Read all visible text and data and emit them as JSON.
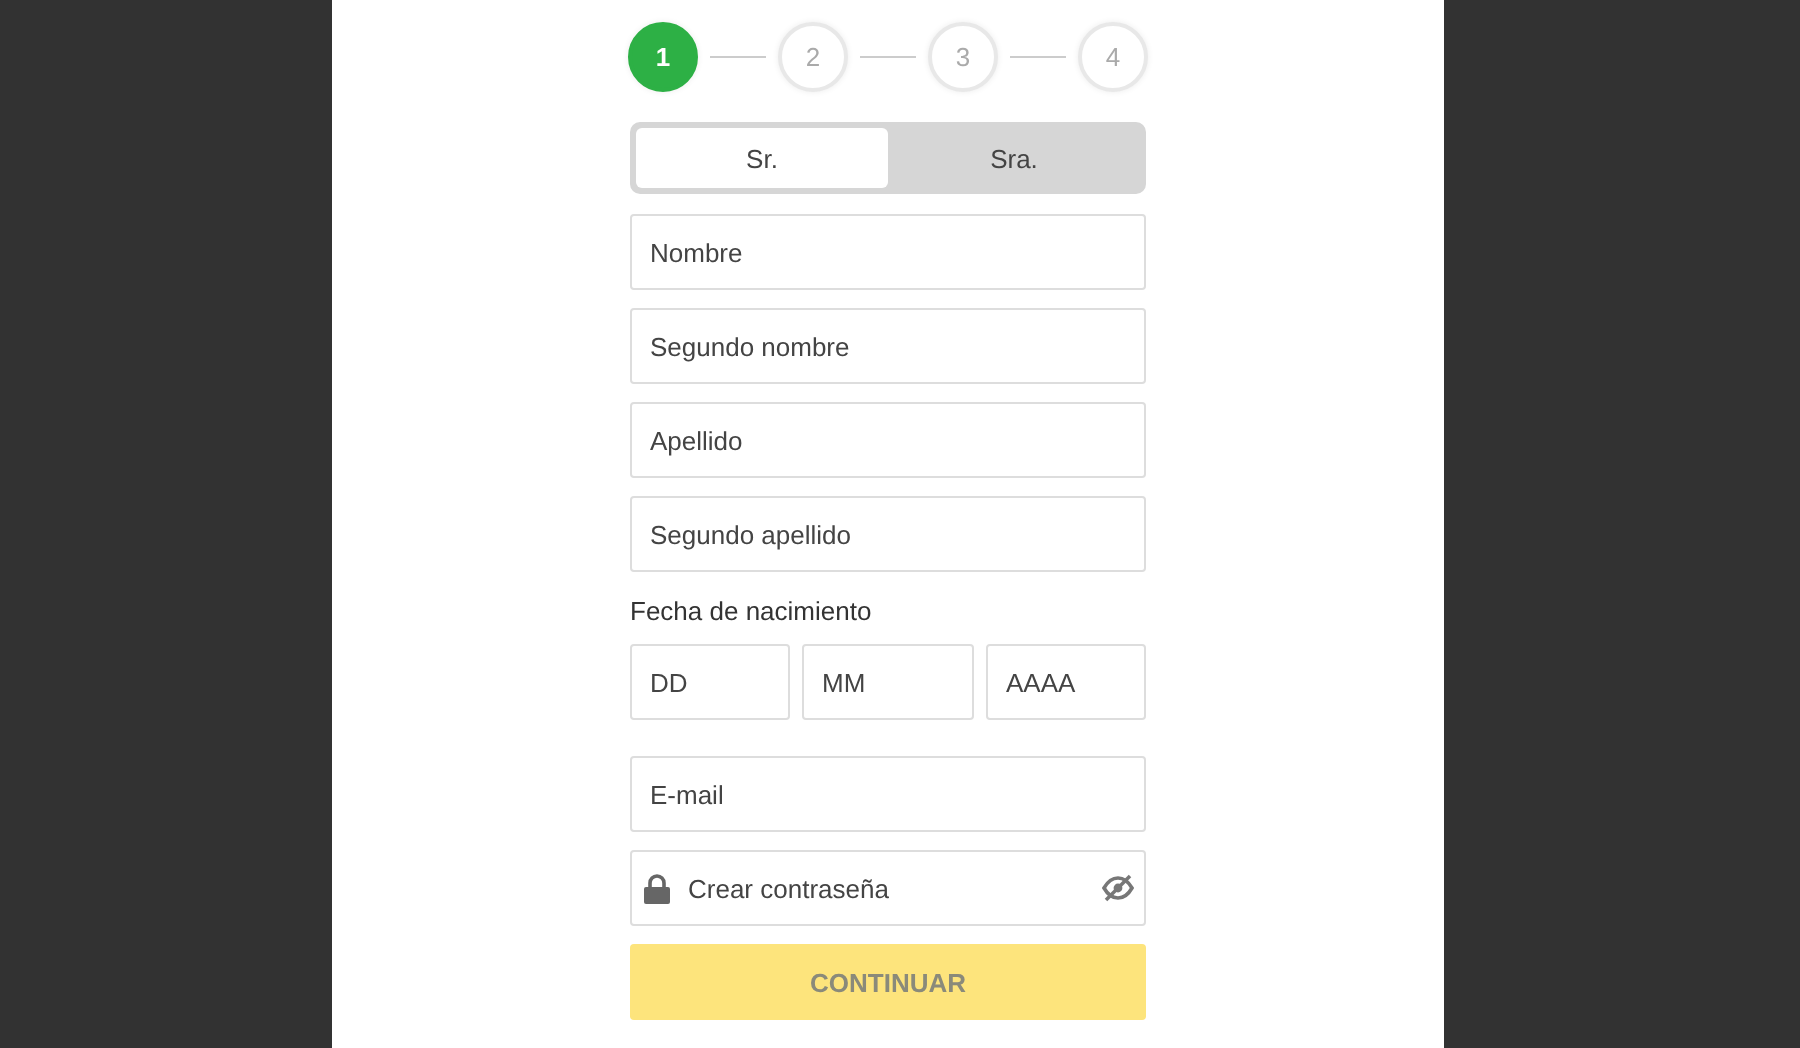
{
  "steps": [
    {
      "label": "1",
      "selected": true
    },
    {
      "label": "2",
      "selected": false
    },
    {
      "label": "3",
      "selected": false
    },
    {
      "label": "4",
      "selected": false
    }
  ],
  "salutation": [
    {
      "label": "Sr.",
      "selected": true
    },
    {
      "label": "Sra.",
      "selected": false
    }
  ],
  "name_fields": [
    {
      "placeholder": "Nombre"
    },
    {
      "placeholder": "Segundo nombre"
    },
    {
      "placeholder": "Apellido"
    },
    {
      "placeholder": "Segundo apellido"
    }
  ],
  "birth_date": {
    "label": "Fecha de nacimiento",
    "fields": [
      {
        "placeholder": "DD"
      },
      {
        "placeholder": "MM"
      },
      {
        "placeholder": "AAAA"
      }
    ]
  },
  "account_fields": [
    {
      "kind": "text",
      "placeholder": "E-mail"
    },
    {
      "kind": "password",
      "placeholder": "Crear contraseña"
    }
  ],
  "submit": {
    "label": "CONTINUAR",
    "disabled": true
  }
}
